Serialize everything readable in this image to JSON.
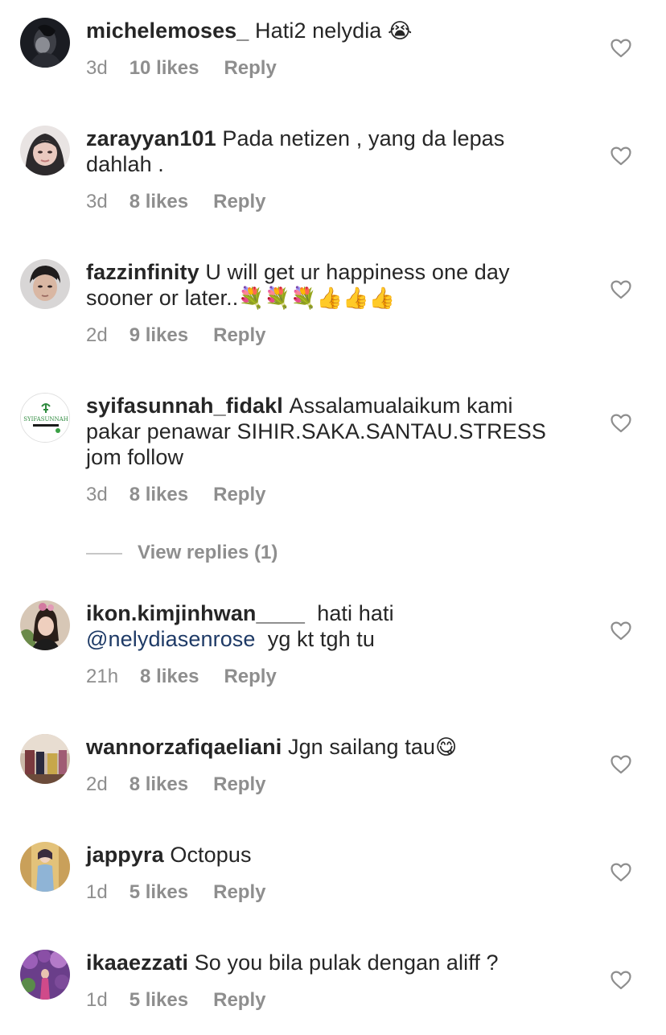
{
  "comments": [
    {
      "username": "michelemoses_",
      "text": "Hati2 nelydia",
      "emoji": "😭",
      "time": "3d",
      "likes": "10 likes",
      "reply": "Reply"
    },
    {
      "username": "zarayyan101",
      "text": "Pada netizen , yang da lepas dahlah .",
      "time": "3d",
      "likes": "8 likes",
      "reply": "Reply"
    },
    {
      "username": "fazzinfinity",
      "text": "U will get ur happiness one day sooner or later..",
      "emoji": "💐💐💐👍👍👍",
      "time": "2d",
      "likes": "9 likes",
      "reply": "Reply"
    },
    {
      "username": "syifasunnah_fidakl",
      "text": "Assalamualaikum kami pakar penawar SIHIR.SAKA.SANTAU.STRESS jom follow",
      "time": "3d",
      "likes": "8 likes",
      "reply": "Reply",
      "avatar_logo_text": "SYIFASUNNAH"
    },
    {
      "username": "ikon.kimjinhwan____",
      "text": "hati hati",
      "mention": "@nelydiasenrose",
      "text_after": "yg kt tgh tu",
      "time": "21h",
      "likes": "8 likes",
      "reply": "Reply"
    },
    {
      "username": "wannorzafiqaeliani",
      "text": "Jgn sailang tau",
      "emoji": "😋",
      "time": "2d",
      "likes": "8 likes",
      "reply": "Reply"
    },
    {
      "username": "jappyra",
      "text": "Octopus",
      "time": "1d",
      "likes": "5 likes",
      "reply": "Reply"
    },
    {
      "username": "ikaaezzati",
      "text": "So you bila pulak dengan aliff ?",
      "time": "1d",
      "likes": "5 likes",
      "reply": "Reply"
    }
  ],
  "view_replies": "View replies (1)",
  "colors": {
    "text": "#262626",
    "meta": "#8e8e8e",
    "mention": "#1e3a66",
    "heart_stroke": "#8e8e8e"
  },
  "icons": {
    "like": "heart-outline-icon"
  }
}
